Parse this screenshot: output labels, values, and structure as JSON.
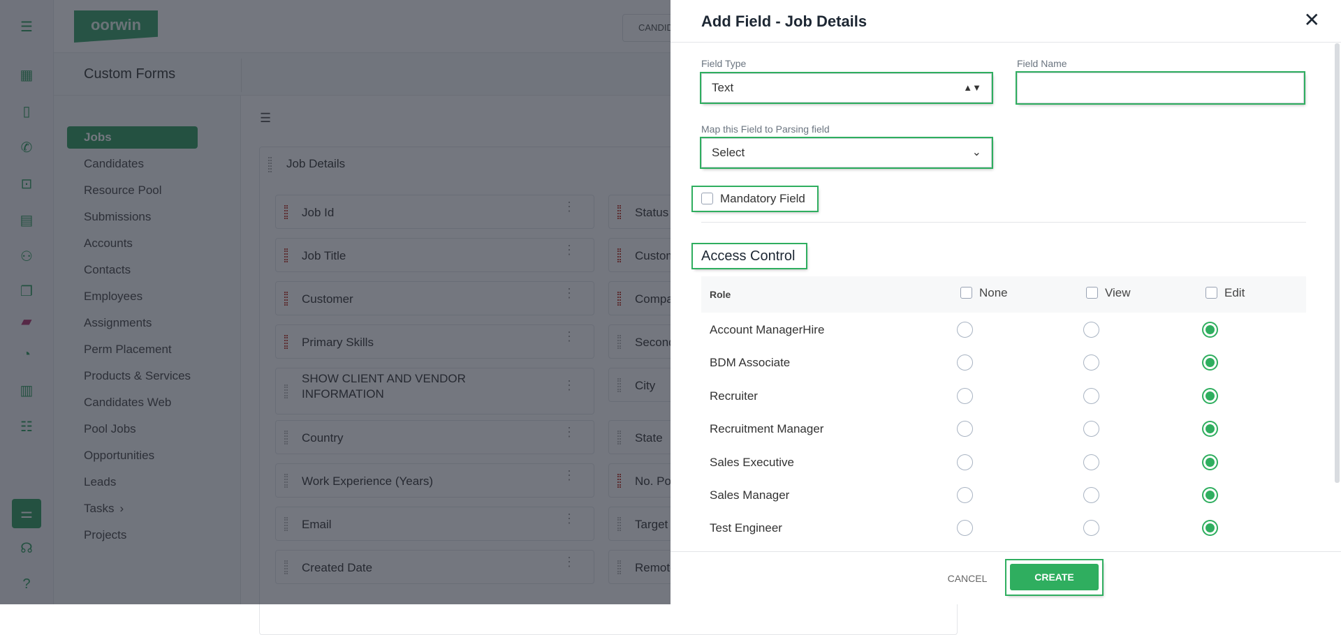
{
  "app": {
    "logo_text": "oorwin",
    "top_button": "CANDIDATES",
    "page_title": "Custom Forms"
  },
  "rail_icons": [
    "menu-icon",
    "dashboard-icon",
    "contacts-icon",
    "phone-book-icon",
    "briefcase-icon",
    "document-location-icon",
    "users-clock-icon",
    "copy-icon",
    "bookmark-new-icon",
    "document-chart-icon",
    "report-icon",
    "list-document-icon",
    "settings-sliders-icon",
    "headset-icon",
    "help-book-icon"
  ],
  "nav": {
    "items": [
      "Jobs",
      "Candidates",
      "Resource Pool",
      "Submissions",
      "Accounts",
      "Contacts",
      "Employees",
      "Assignments",
      "Perm Placement",
      "Products & Services",
      "Candidates Web",
      "Pool Jobs",
      "Opportunities",
      "Leads",
      "Tasks",
      "Projects"
    ],
    "active": "Jobs",
    "tasks_chevron": "›"
  },
  "form": {
    "section_title": "Job Details",
    "left_fields": [
      {
        "label": "Job Id",
        "required": true
      },
      {
        "label": "Job Title",
        "required": true
      },
      {
        "label": "Customer",
        "required": true
      },
      {
        "label": "Primary Skills",
        "required": true
      },
      {
        "label": "SHOW CLIENT AND VENDOR INFORMATION",
        "required": false
      },
      {
        "label": "Country",
        "required": false
      },
      {
        "label": "Work Experience (Years)",
        "required": false
      },
      {
        "label": "Email",
        "required": false
      },
      {
        "label": "Created Date",
        "required": false
      }
    ],
    "right_fields": [
      {
        "label": "Status",
        "required": true
      },
      {
        "label": "Customer",
        "required": true
      },
      {
        "label": "Company",
        "required": true
      },
      {
        "label": "Secondary",
        "required": false
      },
      {
        "label": "City",
        "required": false
      },
      {
        "label": "State",
        "required": false
      },
      {
        "label": "No. Positions",
        "required": true
      },
      {
        "label": "Target",
        "required": false
      },
      {
        "label": "Remote",
        "required": false
      }
    ]
  },
  "modal": {
    "title": "Add Field - Job Details",
    "close": "✕",
    "field_type_label": "Field Type",
    "field_type_value": "Text",
    "field_name_label": "Field Name",
    "field_name_value": "",
    "map_label": "Map this Field to Parsing field",
    "map_value": "Select",
    "mandatory_label": "Mandatory Field",
    "mandatory_checked": false,
    "access_title": "Access Control",
    "columns": {
      "role": "Role",
      "none": "None",
      "view": "View",
      "edit": "Edit"
    },
    "roles": [
      {
        "name": "Account ManagerHire",
        "access": "edit"
      },
      {
        "name": "BDM Associate",
        "access": "edit"
      },
      {
        "name": "Recruiter",
        "access": "edit"
      },
      {
        "name": "Recruitment Manager",
        "access": "edit"
      },
      {
        "name": "Sales Executive",
        "access": "edit"
      },
      {
        "name": "Sales Manager",
        "access": "edit"
      },
      {
        "name": "Test Engineer",
        "access": "edit"
      }
    ],
    "cancel": "CANCEL",
    "create": "CREATE"
  },
  "colors": {
    "brand": "#2e9b5c",
    "accent_green": "#2fae5f",
    "required_marker": "#c0392b"
  }
}
